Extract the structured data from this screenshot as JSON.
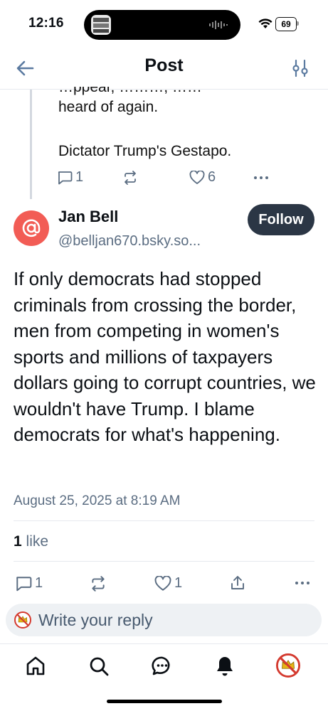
{
  "status_bar": {
    "time": "12:16",
    "battery": "69"
  },
  "header": {
    "title": "Post"
  },
  "parent_post": {
    "line1": "…ppear, ………, ……",
    "line2": "heard of again.",
    "line3": "Dictator Trump's Gestapo.",
    "replies": "1",
    "likes": "6"
  },
  "post": {
    "author_name": "Jan Bell",
    "author_handle": "@belljan670.bsky.so...",
    "follow_label": "Follow",
    "body": "If only democrats had stopped criminals from crossing the border, men from competing in women's sports and millions of taxpayers dollars going to corrupt countries, we wouldn't have Trump. I blame democrats for what's happening.",
    "date": "August 25, 2025 at 8:19 AM",
    "like_count": "1",
    "like_label": "like",
    "replies": "1",
    "likes": "1"
  },
  "reply_bar": {
    "placeholder": "Write your reply"
  },
  "colors": {
    "accent": "#1083fe",
    "avatar": "#f25c55",
    "follow_bg": "#2b3645",
    "muted": "#5b6d82"
  }
}
